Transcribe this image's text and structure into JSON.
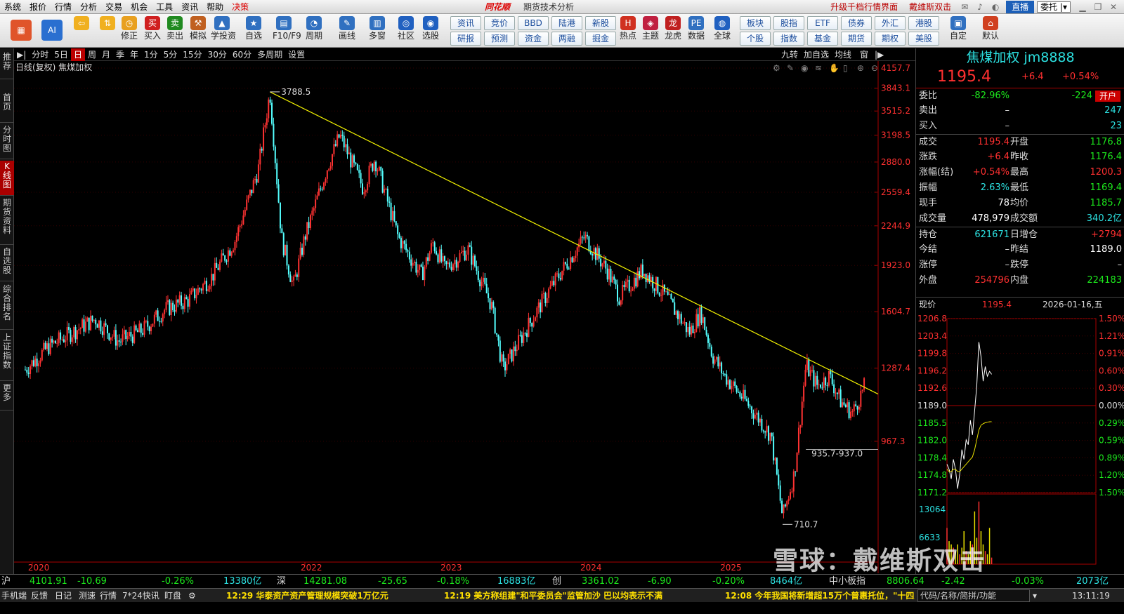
{
  "menubar": {
    "items": [
      "系统",
      "报价",
      "行情",
      "分析",
      "交易",
      "机会",
      "工具",
      "资讯",
      "帮助",
      "决策"
    ],
    "logo": "同花顺",
    "title": "期货技术分析",
    "link1": "升级千档行情界面",
    "link2": "戴维斯双击",
    "live": "直播",
    "combo": "委托 |▾"
  },
  "toolbar": {
    "buttons": [
      {
        "label": "",
        "icon": "windows-icon",
        "color": "#e0542a"
      },
      {
        "label": "",
        "icon": "ai-icon",
        "color": "#2a6fd0"
      },
      {
        "label": "",
        "icon": "back-arrow-icon",
        "color": "#f0b020"
      },
      {
        "label": "",
        "icon": "up-down-arrow-icon",
        "color": "#f0b020"
      },
      {
        "label": "修正",
        "icon": "clock-icon",
        "color": "#e8a020"
      },
      {
        "label": "买入",
        "icon": "buy-icon",
        "color": "#d02020"
      },
      {
        "label": "卖出",
        "icon": "sell-icon",
        "color": "#208a20"
      },
      {
        "label": "模拟",
        "icon": "hammer-icon",
        "color": "#c06020"
      },
      {
        "label": "学投资",
        "icon": "graduation-icon",
        "color": "#3070c0"
      },
      {
        "label": "自选",
        "icon": "star-folder-icon",
        "color": "#3070c0"
      },
      {
        "label": "F10/F9",
        "icon": "f10-icon",
        "color": "#3070c0"
      },
      {
        "label": "周期",
        "icon": "cycle-clock-icon",
        "color": "#3070c0"
      },
      {
        "label": "画线",
        "icon": "pen-icon",
        "color": "#3070c0"
      },
      {
        "label": "多窗",
        "icon": "multi-window-icon",
        "color": "#3070c0"
      },
      {
        "label": "社区",
        "icon": "community-icon",
        "color": "#2060c0"
      },
      {
        "label": "选股",
        "icon": "stock-pick-icon",
        "color": "#2060c0"
      }
    ],
    "quick_top": [
      "资讯",
      "竞价",
      "BBD",
      "陆港",
      "新股"
    ],
    "quick_bottom": [
      "研报",
      "预测",
      "资金",
      "两融",
      "掘金"
    ],
    "buttons2": [
      {
        "label": "热点",
        "icon": "hot-icon",
        "color": "#d03020"
      },
      {
        "label": "主题",
        "icon": "theme-icon",
        "color": "#c02040"
      },
      {
        "label": "龙虎",
        "icon": "dragon-icon",
        "color": "#c02020"
      },
      {
        "label": "数据",
        "icon": "pe-icon",
        "color": "#3070c0"
      },
      {
        "label": "全球",
        "icon": "globe-icon",
        "color": "#2060c0"
      }
    ],
    "quick2_top": [
      "板块",
      "股指",
      "ETF",
      "债券",
      "外汇",
      "港股"
    ],
    "quick2_bottom": [
      "个股",
      "指数",
      "基金",
      "期货",
      "期权",
      "美股"
    ],
    "buttons3": [
      {
        "label": "自定",
        "icon": "custom-icon",
        "color": "#3070c0"
      },
      {
        "label": "默认",
        "icon": "home-icon",
        "color": "#d04020"
      }
    ]
  },
  "lefttabs": [
    "推荐",
    "首页",
    "分时图",
    "K线图",
    "期货资料",
    "自选股",
    "综合排名",
    "上证指数",
    "更多"
  ],
  "periodbar": {
    "items": [
      "分时",
      "5日",
      "日",
      "周",
      "月",
      "季",
      "年",
      "1分",
      "5分",
      "15分",
      "30分",
      "60分",
      "多周期",
      "设置"
    ],
    "right": [
      "九转",
      "加自选",
      "均线",
      "窗"
    ]
  },
  "chart_data": {
    "type": "candlestick",
    "title": "日线(复权) 焦煤加权",
    "x_labels": [
      "2020",
      "2022",
      "2023",
      "2024",
      "2025"
    ],
    "y_ticks": [
      4157.7,
      3843.1,
      3515.2,
      3198.5,
      2880.0,
      2559.4,
      2244.9,
      1923.0,
      1604.7,
      1287.4,
      967.3
    ],
    "y_scale": "log",
    "ylim": [
      627,
      4157.7
    ],
    "annotations": [
      "3788.5",
      "935.7-937.0",
      "710.7"
    ],
    "series": [
      {
        "name": "焦煤加权",
        "points": [
          [
            "2020-01",
            1280
          ],
          [
            "2020-03",
            1400
          ],
          [
            "2020-05",
            1480
          ],
          [
            "2020-07",
            1560
          ],
          [
            "2020-09",
            1430
          ],
          [
            "2020-11",
            1490
          ],
          [
            "2021-01",
            1620
          ],
          [
            "2021-03",
            1680
          ],
          [
            "2021-05",
            1840
          ],
          [
            "2021-07",
            2120
          ],
          [
            "2021-09",
            2800
          ],
          [
            "2021-10",
            3788.5
          ],
          [
            "2021-11",
            2140
          ],
          [
            "2021-12",
            1770
          ],
          [
            "2022-01",
            2150
          ],
          [
            "2022-03",
            2850
          ],
          [
            "2022-04",
            3198
          ],
          [
            "2022-06",
            2600
          ],
          [
            "2022-07",
            2920
          ],
          [
            "2022-09",
            2150
          ],
          [
            "2022-11",
            1850
          ],
          [
            "2022-12",
            2100
          ],
          [
            "2023-01",
            1900
          ],
          [
            "2023-03",
            2050
          ],
          [
            "2023-05",
            1650
          ],
          [
            "2023-06",
            1280
          ],
          [
            "2023-08",
            1500
          ],
          [
            "2023-10",
            1750
          ],
          [
            "2023-12",
            2010
          ],
          [
            "2024-01",
            2150
          ],
          [
            "2024-03",
            1880
          ],
          [
            "2024-04",
            1700
          ],
          [
            "2024-06",
            1890
          ],
          [
            "2024-08",
            1700
          ],
          [
            "2024-10",
            1480
          ],
          [
            "2024-11",
            1600
          ],
          [
            "2024-12",
            1350
          ],
          [
            "2025-01",
            1250
          ],
          [
            "2025-03",
            1120
          ],
          [
            "2025-05",
            990
          ],
          [
            "2025-06",
            720
          ],
          [
            "2025-07",
            850
          ],
          [
            "2025-08",
            1300
          ],
          [
            "2025-09",
            1200
          ],
          [
            "2025-10",
            1250
          ],
          [
            "2025-11",
            1130
          ],
          [
            "2025-12",
            1080
          ],
          [
            "2026-01",
            1195.4
          ]
        ]
      },
      {
        "name": "trendline",
        "points": [
          [
            "2021-10",
            3788.5
          ],
          [
            "2026-01",
            1195.4
          ]
        ]
      }
    ],
    "support_level": 937.0
  },
  "chart_tools": [
    "gear-icon",
    "pen-icon",
    "eye-icon",
    "layers-icon",
    "hand-icon",
    "lock-icon",
    "zoom-in-icon",
    "zoom-out-icon"
  ],
  "quote": {
    "name": "焦煤加权 jm8888",
    "price": "1195.4",
    "change": "+6.4",
    "pct": "+0.54%",
    "rows": [
      {
        "k1": "委比",
        "v1": "-82.96%",
        "v1c": "#1ce81c",
        "v2": "-224",
        "v2c": "#1ce81c",
        "badge": "开户"
      },
      {
        "k1": "卖出",
        "v1": "–",
        "v2": "247",
        "v2c": "#2ce0e0"
      },
      {
        "k1": "买入",
        "v1": "–",
        "v2": "23",
        "v2c": "#2ce0e0"
      },
      {
        "k1": "成交",
        "v1": "1195.4",
        "v1c": "#ff3030",
        "k2": "开盘",
        "v2": "1176.8",
        "v2c": "#1ce81c"
      },
      {
        "k1": "涨跌",
        "v1": "+6.4",
        "v1c": "#ff3030",
        "k2": "昨收",
        "v2": "1176.4",
        "v2c": "#1ce81c"
      },
      {
        "k1": "涨幅(结)",
        "v1": "+0.54%",
        "v1c": "#ff3030",
        "k2": "最高",
        "v2": "1200.3",
        "v2c": "#ff3030"
      },
      {
        "k1": "振幅",
        "v1": "2.63%",
        "v1c": "#2ce0e0",
        "k2": "最低",
        "v2": "1169.4",
        "v2c": "#1ce81c"
      },
      {
        "k1": "现手",
        "v1": "78",
        "v1c": "#ffffff",
        "k2": "均价",
        "v2": "1185.7",
        "v2c": "#1ce81c"
      },
      {
        "k1": "成交量",
        "v1": "478,979",
        "v1c": "#ffffff",
        "k2": "成交额",
        "v2": "340.2亿",
        "v2c": "#2ce0e0"
      },
      {
        "k1": "持仓",
        "v1": "621671",
        "v1c": "#2ce0e0",
        "k2": "日增仓",
        "v2": "+2794",
        "v2c": "#ff3030"
      },
      {
        "k1": "今结",
        "v1": "–",
        "v1c": "#ddd",
        "k2": "昨结",
        "v2": "1189.0",
        "v2c": "#ffffff"
      },
      {
        "k1": "涨停",
        "v1": "–",
        "v1c": "#ddd",
        "k2": "跌停",
        "v2": "–",
        "v2c": "#ddd"
      },
      {
        "k1": "外盘",
        "v1": "254796",
        "v1c": "#ff3030",
        "k2": "内盘",
        "v2": "224183",
        "v2c": "#1ce81c"
      }
    ],
    "mini_label": "现价",
    "mini_price": "1195.4",
    "mini_date": "2026-01-16,五"
  },
  "mini_chart": {
    "y_left": [
      "1206.8",
      "1203.4",
      "1199.8",
      "1196.2",
      "1192.6",
      "1189.0",
      "1185.5",
      "1182.0",
      "1178.4",
      "1174.8",
      "1171.2"
    ],
    "y_right": [
      "1.50%",
      "1.21%",
      "0.91%",
      "0.60%",
      "0.30%",
      "0.00%",
      "0.29%",
      "0.59%",
      "0.89%",
      "1.20%",
      "1.50%"
    ],
    "vol_labels": [
      "13064",
      "6633"
    ],
    "prices": [
      1177,
      1176,
      1174,
      1178,
      1176,
      1172,
      1175,
      1180,
      1178,
      1182,
      1181,
      1186,
      1183,
      1188,
      1193,
      1202,
      1199,
      1194,
      1197,
      1195,
      1196,
      1195.4
    ],
    "avg": [
      1176,
      1175.5,
      1175.5,
      1176,
      1176,
      1175.5,
      1175.5,
      1176,
      1176.5,
      1177,
      1177.5,
      1178,
      1178.5,
      1180,
      1182,
      1184,
      1185,
      1185.3,
      1185.5,
      1185.6,
      1185.7,
      1185.7
    ],
    "volumes": [
      0.55,
      0.35,
      0.3,
      0.25,
      0.2,
      0.3,
      0.15,
      0.25,
      0.5,
      0.2,
      0.15,
      0.35,
      0.3,
      0.8,
      0.4,
      0.95,
      0.5,
      0.3,
      0.2,
      0.15,
      0.55,
      0.1
    ]
  },
  "indexbar": [
    {
      "t": "沪",
      "c": "#ddd"
    },
    {
      "t": "4101.91",
      "c": "#1ce81c"
    },
    {
      "t": "-10.69",
      "c": "#1ce81c"
    },
    {
      "t": "-0.26%",
      "c": "#1ce81c"
    },
    {
      "t": "13380亿",
      "c": "#2ce0e0"
    },
    {
      "t": "深",
      "c": "#ddd"
    },
    {
      "t": "14281.08",
      "c": "#1ce81c"
    },
    {
      "t": "-25.65",
      "c": "#1ce81c"
    },
    {
      "t": "-0.18%",
      "c": "#1ce81c"
    },
    {
      "t": "16883亿",
      "c": "#2ce0e0"
    },
    {
      "t": "创",
      "c": "#ddd"
    },
    {
      "t": "3361.02",
      "c": "#1ce81c"
    },
    {
      "t": "-6.90",
      "c": "#1ce81c"
    },
    {
      "t": "-0.20%",
      "c": "#1ce81c"
    },
    {
      "t": "8464亿",
      "c": "#2ce0e0"
    },
    {
      "t": "中小板指",
      "c": "#ddd"
    },
    {
      "t": "8806.64",
      "c": "#1ce81c"
    },
    {
      "t": "-2.42",
      "c": "#1ce81c"
    },
    {
      "t": "-0.03%",
      "c": "#1ce81c"
    },
    {
      "t": "2073亿",
      "c": "#2ce0e0"
    }
  ],
  "statusbar": {
    "tabs": [
      "手机端",
      "反馈",
      "日记",
      "测速",
      "行情",
      "7*24快讯",
      "盯盘"
    ],
    "news": [
      "12:29 华泰资产资产管理规模突破1万亿元",
      "12:19 美方称组建\"和平委员会\"监管加沙 巴以均表示不满",
      "12:08 今年我国将新增超15万个普惠托位，\"十四五"
    ],
    "search": "代码/名称/简拼/功能",
    "time": "13:11:19"
  },
  "watermark": "雪球：戴维斯双击"
}
